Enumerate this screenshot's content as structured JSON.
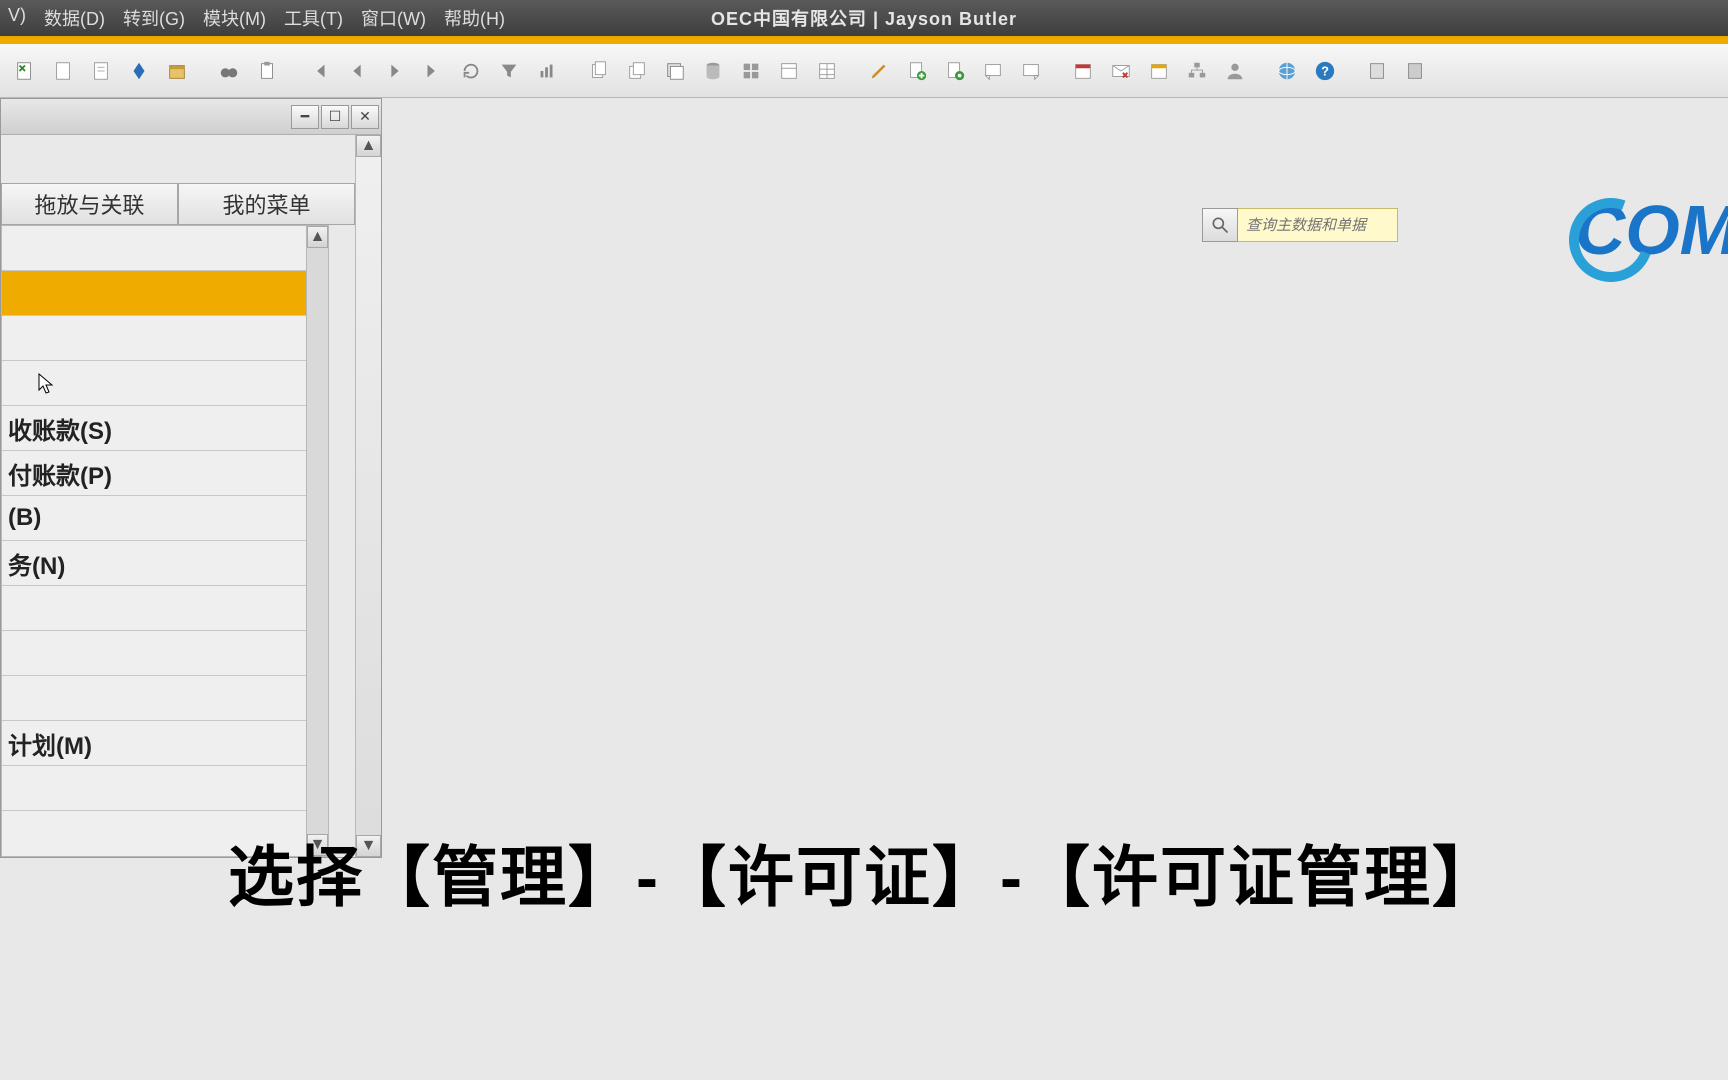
{
  "titlebar": {
    "app_title": "OEC中国有限公司  |  Jayson Butler",
    "menus": [
      "V)",
      "数据(D)",
      "转到(G)",
      "模块(M)",
      "工具(T)",
      "窗口(W)",
      "帮助(H)"
    ]
  },
  "toolbar": {
    "icons": [
      "doc-x-icon",
      "doc-icon",
      "page-icon",
      "diamond-icon",
      "package-icon",
      "binoculars-icon",
      "clipboard-icon",
      "first-icon",
      "prev-icon",
      "next-icon",
      "last-icon",
      "refresh-icon",
      "filter-icon",
      "chart-icon",
      "copy-icon",
      "copy2-icon",
      "layers-icon",
      "db-icon",
      "grid-icon",
      "form-icon",
      "table-icon",
      "pencil-icon",
      "new-doc-icon",
      "doc-gear-icon",
      "note-icon",
      "note2-icon",
      "calendar-icon",
      "mail-x-icon",
      "calendar2-icon",
      "org-icon",
      "person-icon",
      "globe-icon",
      "help-icon",
      "book-icon",
      "book2-icon"
    ]
  },
  "search": {
    "placeholder": "查询主数据和单据"
  },
  "brand": "OM",
  "panel": {
    "tabs": [
      "拖放与关联",
      "我的菜单"
    ],
    "modules": [
      {
        "label": "",
        "selected": false
      },
      {
        "label": "",
        "selected": true
      },
      {
        "label": "",
        "selected": false
      },
      {
        "label": "",
        "selected": false
      },
      {
        "label": "收账款(S)",
        "selected": false
      },
      {
        "label": "付账款(P)",
        "selected": false
      },
      {
        "label": "(B)",
        "selected": false
      },
      {
        "label": "务(N)",
        "selected": false
      },
      {
        "label": "",
        "selected": false
      },
      {
        "label": "",
        "selected": false
      },
      {
        "label": "",
        "selected": false
      },
      {
        "label": "计划(M)",
        "selected": false
      },
      {
        "label": "",
        "selected": false
      }
    ]
  },
  "caption": "选择【管理】-【许可证】-【许可证管理】"
}
